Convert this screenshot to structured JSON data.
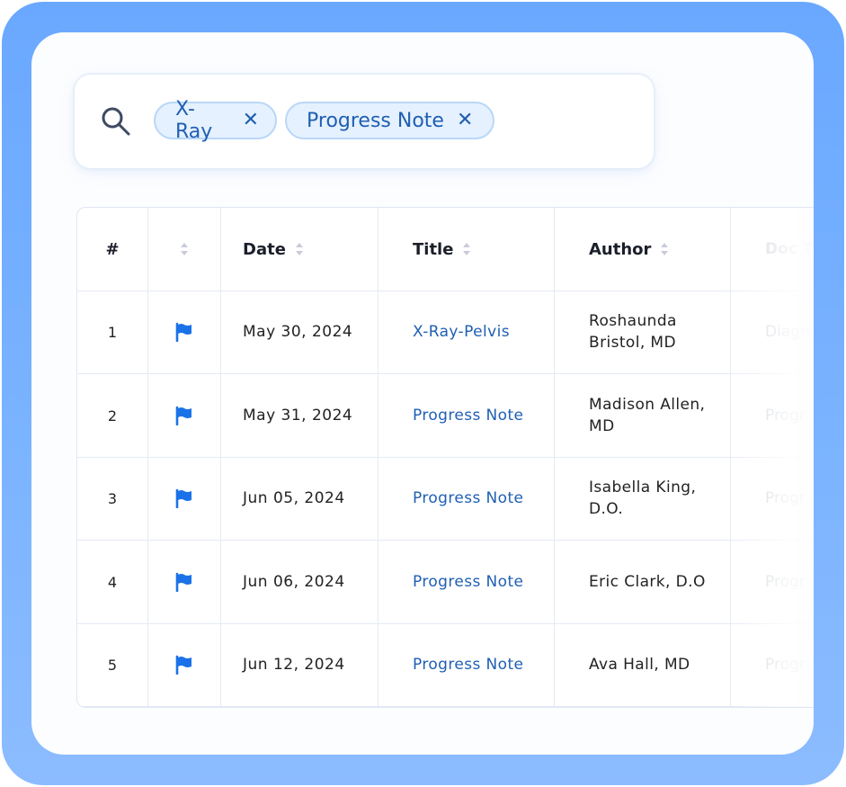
{
  "search": {
    "chips": [
      {
        "label": "X-Ray"
      },
      {
        "label": "Progress Note"
      }
    ],
    "chip_remove_symbol": "✕"
  },
  "table": {
    "headers": {
      "number": "#",
      "date": "Date",
      "title": "Title",
      "author": "Author",
      "doc_type": "Doc T"
    },
    "rows": [
      {
        "number": "1",
        "date": "May 30, 2024",
        "title": "X-Ray-Pelvis",
        "author": "Roshaunda Bristol, MD",
        "doc_type": "Diagn"
      },
      {
        "number": "2",
        "date": "May 31, 2024",
        "title": "Progress Note",
        "author": "Madison Allen, MD",
        "doc_type": "Progr"
      },
      {
        "number": "3",
        "date": "Jun 05, 2024",
        "title": "Progress Note",
        "author": "Isabella King, D.O.",
        "doc_type": "Progr"
      },
      {
        "number": "4",
        "date": "Jun 06, 2024",
        "title": "Progress Note",
        "author": "Eric Clark, D.O",
        "doc_type": "Progr"
      },
      {
        "number": "5",
        "date": "Jun 12, 2024",
        "title": "Progress Note",
        "author": "Ava Hall, MD",
        "doc_type": "Progr"
      }
    ]
  },
  "colors": {
    "frame": "#6aa8ff",
    "accent": "#1f5fb3",
    "flag": "#1b72e8",
    "chip_bg": "#e6f1ff"
  },
  "icons": {
    "search": "search-icon",
    "flag": "flag-icon",
    "sort": "sort-icon",
    "remove": "close-icon"
  }
}
